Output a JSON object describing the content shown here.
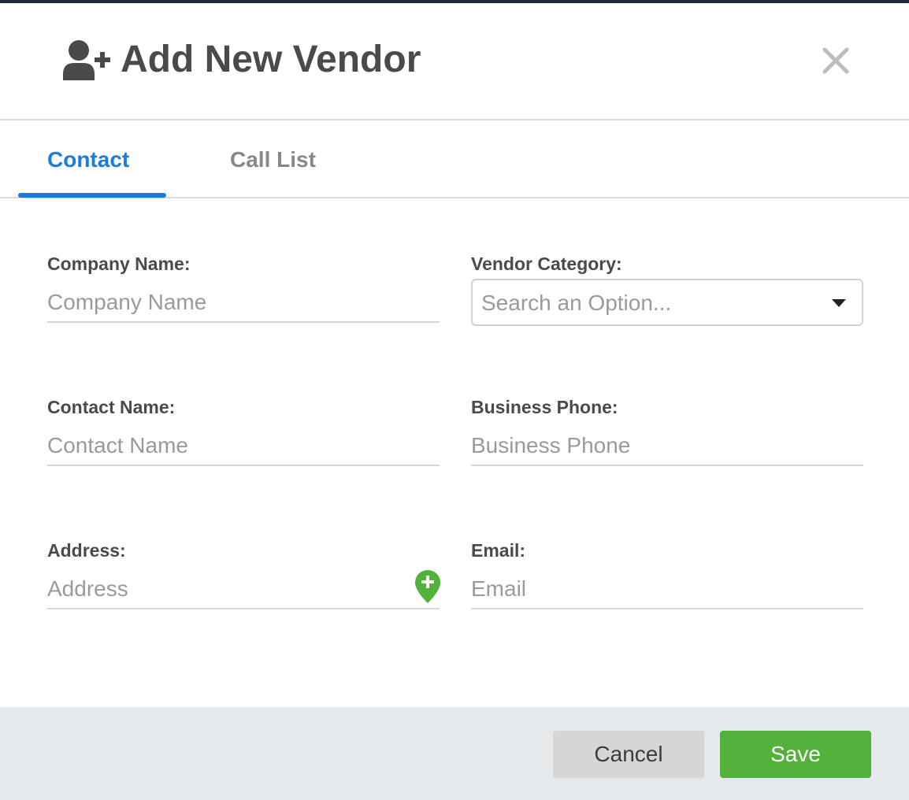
{
  "modal": {
    "title": "Add New Vendor",
    "title_icon": "user-plus-icon",
    "close_icon": "close-icon"
  },
  "tabs": [
    {
      "label": "Contact",
      "active": true
    },
    {
      "label": "Call List",
      "active": false
    }
  ],
  "form": {
    "company_name": {
      "label": "Company Name:",
      "placeholder": "Company Name",
      "value": ""
    },
    "vendor_category": {
      "label": "Vendor Category:",
      "placeholder": "Search an Option...",
      "icon": "caret-down-icon"
    },
    "contact_name": {
      "label": "Contact Name:",
      "placeholder": "Contact Name",
      "value": ""
    },
    "business_phone": {
      "label": "Business Phone:",
      "placeholder": "Business Phone",
      "value": ""
    },
    "address": {
      "label": "Address:",
      "placeholder": "Address",
      "value": "",
      "icon": "map-pin-plus-icon"
    },
    "email": {
      "label": "Email:",
      "placeholder": "Email",
      "value": ""
    }
  },
  "footer": {
    "cancel_label": "Cancel",
    "save_label": "Save"
  },
  "colors": {
    "accent": "#1a7be0",
    "save": "#52b13a",
    "cancel": "#d6d6d6",
    "footer_bg": "#e6e9ec",
    "pin": "#52b13a"
  }
}
